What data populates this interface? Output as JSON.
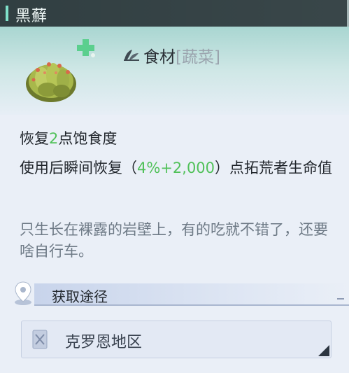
{
  "header": {
    "title": "黑蘚"
  },
  "category": {
    "label": "食材",
    "sub": "[蔬菜]"
  },
  "effects": {
    "line1_prefix": "恢复",
    "line1_value": "2",
    "line1_suffix": "点饱食度",
    "line2_prefix": "使用后瞬间恢复（",
    "line2_value": "4%+2,000",
    "line2_suffix": "）点拓荒者生命值"
  },
  "flavor": "只生长在裸露的岩壁上，有的吃就不错了，还要啥自行车。",
  "source": {
    "heading": "获取途径",
    "region": "克罗恩地区"
  },
  "colors": {
    "accent": "#7fe0c9",
    "value_green": "#51c15a",
    "title_bg": "#2d3b3e"
  },
  "icons": [
    "moss-item-icon",
    "healing-cross-icon",
    "food-category-icon",
    "location-pin-icon",
    "region-map-icon"
  ]
}
